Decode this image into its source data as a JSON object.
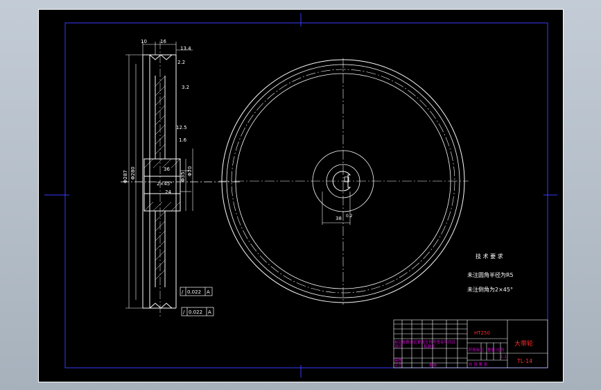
{
  "drawing": {
    "dims": {
      "width_10": "10",
      "width_16": "16",
      "dim_13_4": "13.4",
      "dim_2_2": "2.2",
      "roughness_top": "3.2",
      "roughness_mid": "12.5",
      "roughness_side": "1.6",
      "dia_outer": "Φ287",
      "dia_pitch": "Φ280",
      "hub_width": "36",
      "hub_chamfer": "2×45°",
      "hub_len": "24",
      "bore_dia": "Φ35",
      "hub_dia": "Φ70",
      "keyway_depth": "38",
      "keyway_tol": "0.2"
    },
    "gdt": {
      "frame1_tol": "0.022",
      "frame1_datum": "A",
      "frame2_tol": "0.022",
      "frame2_datum": "A"
    },
    "notes": {
      "title": "技 术 要 求",
      "line1": "未注圆角半径为R5",
      "line2": "未注倒角为2×45°"
    },
    "title_block": {
      "material": "HT250",
      "part_name": "大带轮",
      "drawing_no": "TL-14",
      "row_label1": "标记处数分区更改文件号签名年月日",
      "label_design": "设计",
      "label_std": "标准化",
      "label_stage": "阶段标记",
      "label_weight": "重量",
      "label_scale": "比例",
      "scale_value": "1:1",
      "label_review": "审核",
      "label_craft": "工艺",
      "label_approve": "批准",
      "label_sheets": "共  张 第  张"
    }
  }
}
